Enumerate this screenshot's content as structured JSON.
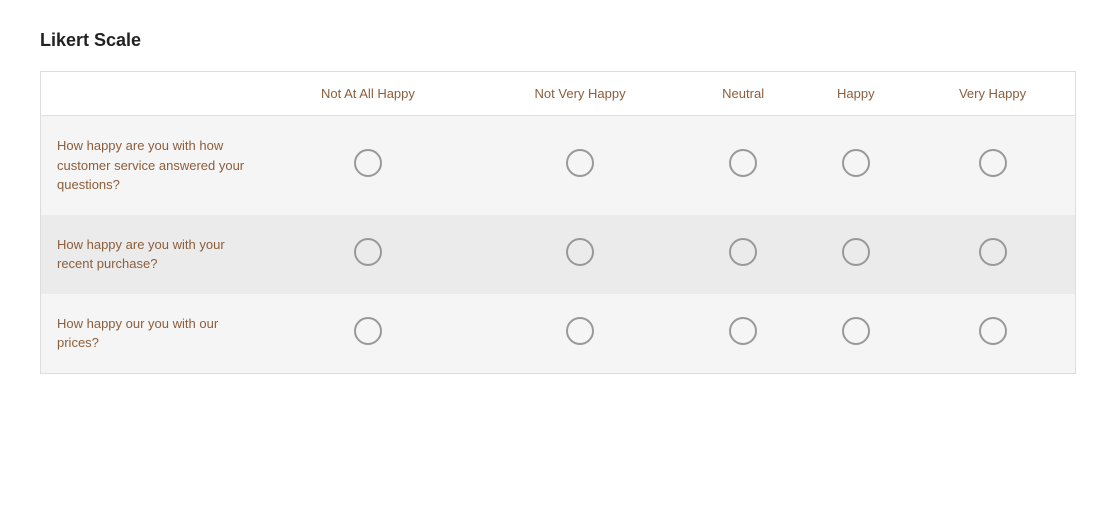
{
  "title": "Likert Scale",
  "columns": {
    "question": "",
    "col1": "Not At All Happy",
    "col2": "Not Very Happy",
    "col3": "Neutral",
    "col4": "Happy",
    "col5": "Very Happy"
  },
  "rows": [
    {
      "question": "How happy are you with how customer service answered your questions?"
    },
    {
      "question": "How happy are you with your recent purchase?"
    },
    {
      "question": "How happy our you with our prices?"
    }
  ]
}
